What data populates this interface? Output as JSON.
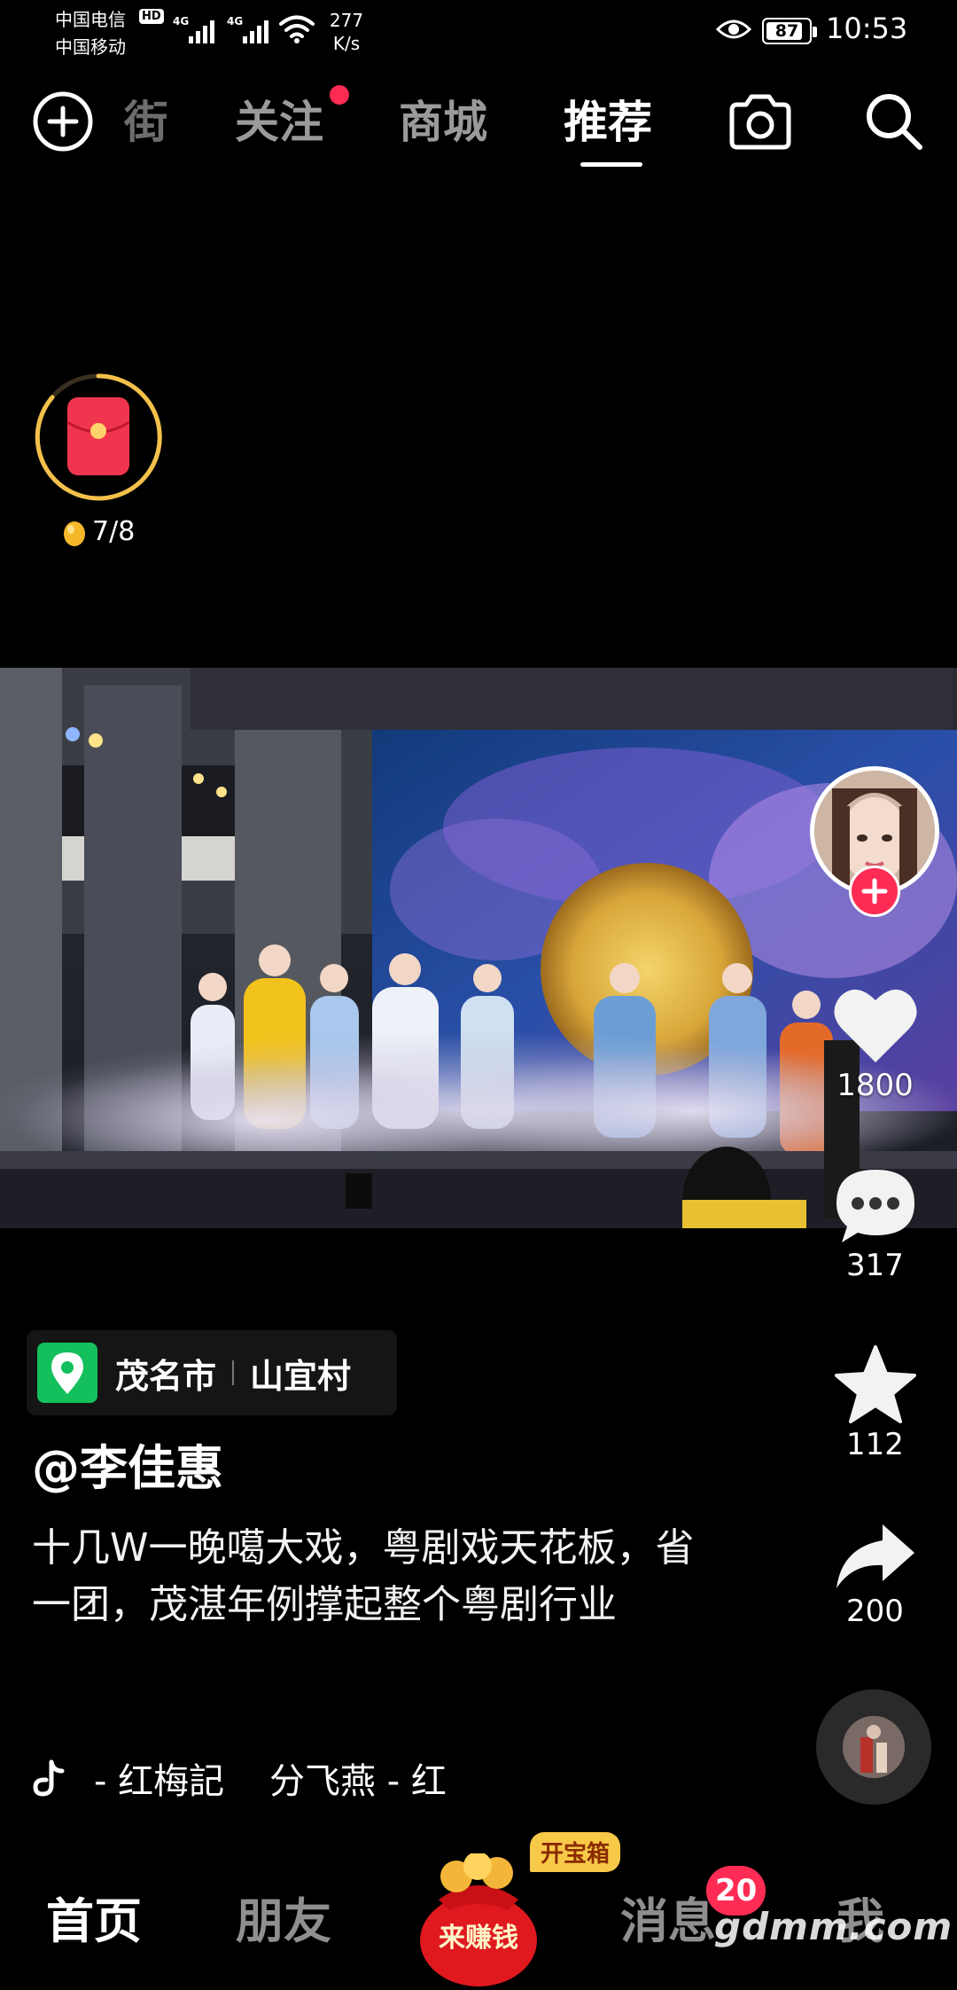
{
  "status_bar": {
    "carrier1": "中国电信",
    "hd": "HD",
    "carrier2": "中国移动",
    "net_type_1": "4G",
    "net_type_2": "4G",
    "net_speed_value": "277",
    "net_speed_unit": "K/s",
    "battery": "87",
    "battery_level": 0.87,
    "time": "10:53",
    "icons": [
      "signal-icon",
      "wifi-icon",
      "eye-icon",
      "battery-icon"
    ]
  },
  "top_nav": {
    "faded_tab": "街",
    "tabs": [
      {
        "label": "关注",
        "has_dot": true
      },
      {
        "label": "商城"
      },
      {
        "label": "推荐",
        "active": true
      }
    ],
    "icons": [
      "plus-circle-icon",
      "camera-icon",
      "search-icon"
    ]
  },
  "red_packet": {
    "progress": "7/8"
  },
  "video": {
    "side_actions": {
      "likes": "1800",
      "comments": "317",
      "favorites": "112",
      "shares": "200"
    }
  },
  "caption": {
    "location_city": "茂名市",
    "location_village": "山宜村",
    "author": "@李佳惠",
    "text": "十几W一晚噶大戏，粤剧戏天花板，省一团，茂湛年例撑起整个粤剧行业",
    "music": "- 红梅記    分飞燕 - 红"
  },
  "bottom_tabs": {
    "home": "首页",
    "friends": "朋友",
    "earn": "来赚钱",
    "treasure": "开宝箱",
    "messages": "消息",
    "messages_badge": "20",
    "me": "我",
    "watermark": "gdmm.com"
  },
  "colors": {
    "accent_red": "#fe2c55",
    "location_green": "#13c05b",
    "ring_gold": "#f3c04a"
  }
}
